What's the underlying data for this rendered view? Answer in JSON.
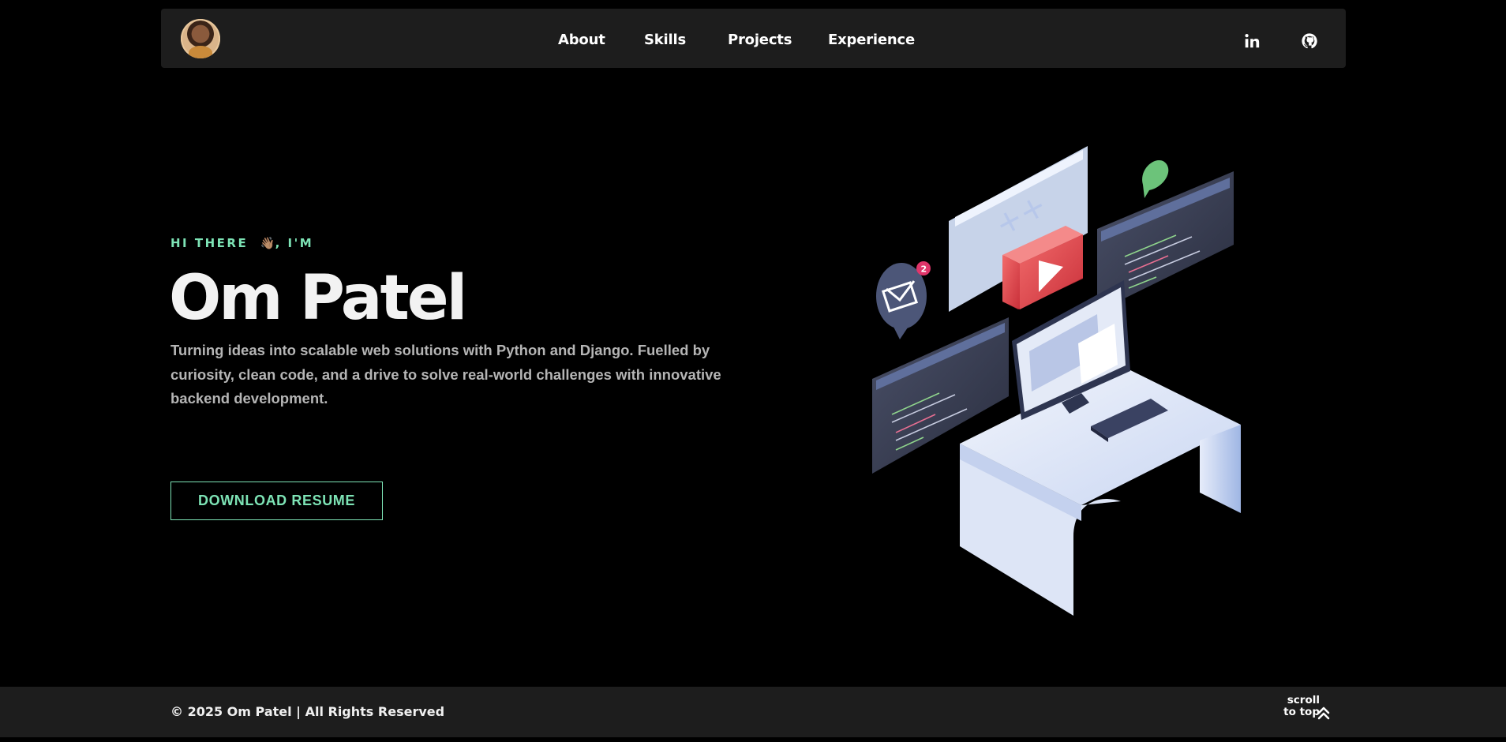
{
  "nav": {
    "links": [
      "About",
      "Skills",
      "Projects",
      "Experience"
    ],
    "social": [
      "linkedin-icon",
      "github-icon"
    ]
  },
  "hero": {
    "eyebrow_prefix": "HI THERE",
    "wave_emoji": "👋🏽",
    "eyebrow_suffix": ", I'M",
    "name": "Om Patel",
    "description": "Turning ideas into scalable web solutions with Python and Django. Fuelled by curiosity, clean code, and a drive to solve real-world challenges with innovative backend development.",
    "button_label": "DOWNLOAD RESUME",
    "notification_count": "2"
  },
  "footer": {
    "copyright": "© 2025 Om Patel | All Rights Reserved",
    "scroll_line1": "scroll",
    "scroll_line2": "to top"
  },
  "colors": {
    "accent": "#7de3b5",
    "background": "#000000",
    "panel": "#1d1d1d"
  }
}
